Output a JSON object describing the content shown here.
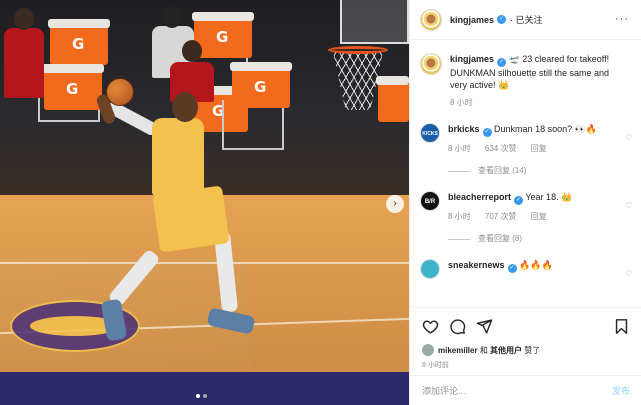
{
  "post": {
    "author": "kingjames",
    "follow_label": "· 已关注",
    "more_label": "···"
  },
  "caption": {
    "username": "kingjames",
    "text": "🛫 23 cleared for takeoff! DUNKMAN silhouette still the same and very active! 👑",
    "time": "8 小时"
  },
  "comments": [
    {
      "username": "brkicks",
      "avatar_text": "KICKS",
      "text": "Dunkman 18 soon? 👀🔥",
      "time": "8 小时",
      "likes": "634 次赞",
      "reply_label": "回复",
      "view_replies": "查看回复 (14)"
    },
    {
      "username": "bleacherreport",
      "avatar_text": "B/R",
      "text": "Year 18. 👑",
      "time": "8 小时",
      "likes": "707 次赞",
      "reply_label": "回复",
      "view_replies": "查看回复 (8)"
    },
    {
      "username": "sneakernews",
      "text": "🔥🔥🔥"
    }
  ],
  "likes_line": {
    "user": "mikemiller",
    "connector": "和",
    "others": "其他用户",
    "suffix": "赞了"
  },
  "post_time": "8 小时前",
  "comment_input": {
    "placeholder": "添加评论...",
    "post_label": "发布"
  },
  "icons": {
    "like": "heart-icon",
    "comment": "comment-icon",
    "share": "send-icon",
    "save": "bookmark-icon",
    "next": "chevron-right-icon"
  },
  "colors": {
    "verified": "#3897f0",
    "accent_blue_disabled": "#b2dffc",
    "lakers_gold": "#f2c14e",
    "gatorade_orange": "#f26b1d"
  },
  "carousel": {
    "count": 2,
    "active": 0
  }
}
